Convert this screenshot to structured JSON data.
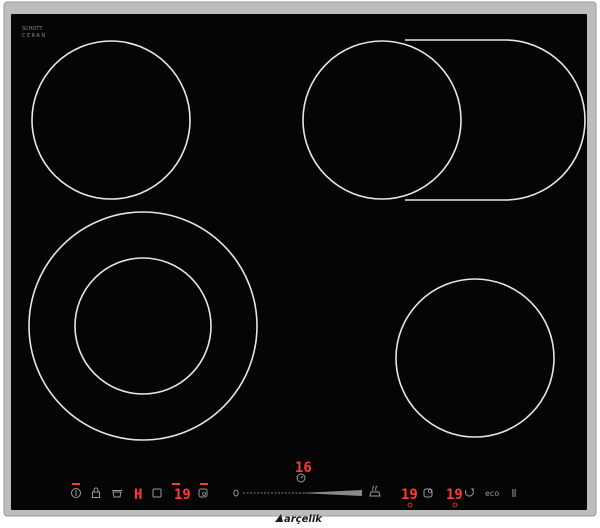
{
  "branding": {
    "glass_maker_line1": "SCHOTT",
    "glass_maker_line2": "CERAN",
    "brand": "arçelik"
  },
  "colors": {
    "frame": "#b9b9b9",
    "glass": "#050505",
    "ring": "#e6e6e6",
    "display_red": "#ff3b2f",
    "symbol_gray": "#9a9a9a"
  },
  "zones": [
    {
      "name": "zone-rear-left",
      "type": "single"
    },
    {
      "name": "zone-rear-right",
      "type": "oval-extended"
    },
    {
      "name": "zone-front-left",
      "type": "dual-ring"
    },
    {
      "name": "zone-front-right",
      "type": "single"
    }
  ],
  "controls": {
    "power_icon": "power-icon",
    "lock_icon": "lock-icon",
    "pot_icon": "pot-icon",
    "heat_level_left": "H",
    "power_level_front_left": "19",
    "power_level_rear_left": "19",
    "timer_display": "16",
    "timer_icon": "timer-icon",
    "slider": "power-slider",
    "keep_warm_icon": "keep-warm-icon",
    "power_level_front_right": "19",
    "power_level_rear_right": "19",
    "eco_label": "eco",
    "pause_icon": "pause-icon"
  }
}
